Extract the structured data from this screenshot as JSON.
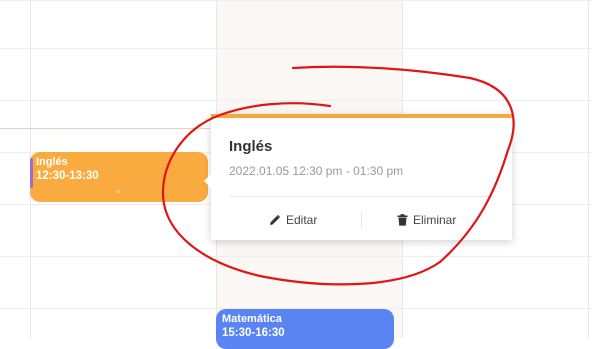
{
  "colors": {
    "ingles_event": "#f9ab3f",
    "matematica_event": "#5a84f2",
    "popover_accent": "#f4a93f",
    "annotation_stroke": "#e01515"
  },
  "calendar": {
    "events": [
      {
        "title": "Inglés",
        "time": "12:30-13:30"
      },
      {
        "title": "Matemática",
        "time": "15:30-16:30"
      }
    ]
  },
  "popover": {
    "title": "Inglés",
    "date_range": "2022.01.05 12:30 pm - 01:30 pm",
    "edit_label": "Editar",
    "delete_label": "Eliminar",
    "edit_icon": "pencil-icon",
    "delete_icon": "trash-icon"
  }
}
